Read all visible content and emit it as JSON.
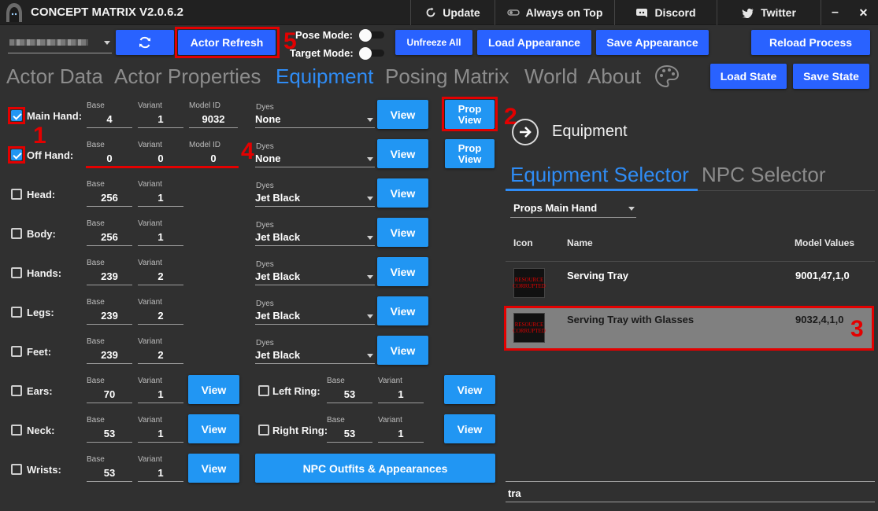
{
  "titlebar": {
    "title": "CONCEPT MATRIX V2.0.6.2",
    "update": "Update",
    "always_on_top": "Always on Top",
    "discord": "Discord",
    "twitter": "Twitter",
    "minimize": "–",
    "close": "✕"
  },
  "toolbar": {
    "actor_select_value": "",
    "actor_refresh": "Actor Refresh",
    "pose_mode": "Pose Mode:",
    "target_mode": "Target Mode:",
    "unfreeze_all": "Unfreeze All",
    "load_appearance": "Load Appearance",
    "save_appearance": "Save Appearance",
    "reload_process": "Reload Process",
    "load_state": "Load State",
    "save_state": "Save State"
  },
  "tabs": [
    "Actor Data",
    "Actor Properties",
    "Equipment",
    "Posing Matrix",
    "World",
    "About"
  ],
  "active_tab": "Equipment",
  "captions": {
    "base": "Base",
    "variant": "Variant",
    "model_id": "Model ID",
    "dyes": "Dyes"
  },
  "slots": [
    {
      "label": "Main Hand:",
      "base": "4",
      "variant": "1",
      "model_id": "9032",
      "dye": "None",
      "view": "View",
      "prop_view": "Prop\nView",
      "checked": true
    },
    {
      "label": "Off Hand:",
      "base": "0",
      "variant": "0",
      "model_id": "0",
      "dye": "None",
      "view": "View",
      "prop_view": "Prop\nView",
      "checked": true
    },
    {
      "label": "Head:",
      "base": "256",
      "variant": "1",
      "dye": "Jet Black",
      "view": "View",
      "checked": false
    },
    {
      "label": "Body:",
      "base": "256",
      "variant": "1",
      "dye": "Jet Black",
      "view": "View",
      "checked": false
    },
    {
      "label": "Hands:",
      "base": "239",
      "variant": "2",
      "dye": "Jet Black",
      "view": "View",
      "checked": false
    },
    {
      "label": "Legs:",
      "base": "239",
      "variant": "2",
      "dye": "Jet Black",
      "view": "View",
      "checked": false
    },
    {
      "label": "Feet:",
      "base": "239",
      "variant": "2",
      "dye": "Jet Black",
      "view": "View",
      "checked": false
    },
    {
      "label": "Ears:",
      "base": "70",
      "variant": "1",
      "view": "View",
      "checked": false
    },
    {
      "label": "Neck:",
      "base": "53",
      "variant": "1",
      "view": "View",
      "checked": false
    },
    {
      "label": "Wrists:",
      "base": "53",
      "variant": "1",
      "view": "View",
      "checked": false
    }
  ],
  "rings": [
    {
      "label": "Left Ring:",
      "base": "53",
      "variant": "1",
      "view": "View",
      "checked": false
    },
    {
      "label": "Right Ring:",
      "base": "53",
      "variant": "1",
      "view": "View",
      "checked": false
    }
  ],
  "npc_outfits": "NPC Outfits & Appearances",
  "right_panel": {
    "header": "Equipment",
    "tab_equipment": "Equipment Selector",
    "tab_npc": "NPC Selector",
    "category": "Props Main Hand",
    "col_icon": "Icon",
    "col_name": "Name",
    "col_model": "Model Values",
    "rows": [
      {
        "icon_text": "RESOURCE CORRUPTED",
        "name": "Serving Tray",
        "model": "9001,47,1,0",
        "selected": false
      },
      {
        "icon_text": "RESOURCE CORRUPTED",
        "name": "Serving Tray with Glasses",
        "model": "9032,4,1,0",
        "selected": true
      }
    ],
    "search_value": "tra"
  },
  "annotations": [
    "1",
    "2",
    "3",
    "4",
    "5"
  ],
  "colors": {
    "accent": "#2962ff",
    "light_button": "#2196f3",
    "active_tab": "#2f8cf5",
    "annotation": "#e30000",
    "background": "#303030"
  }
}
